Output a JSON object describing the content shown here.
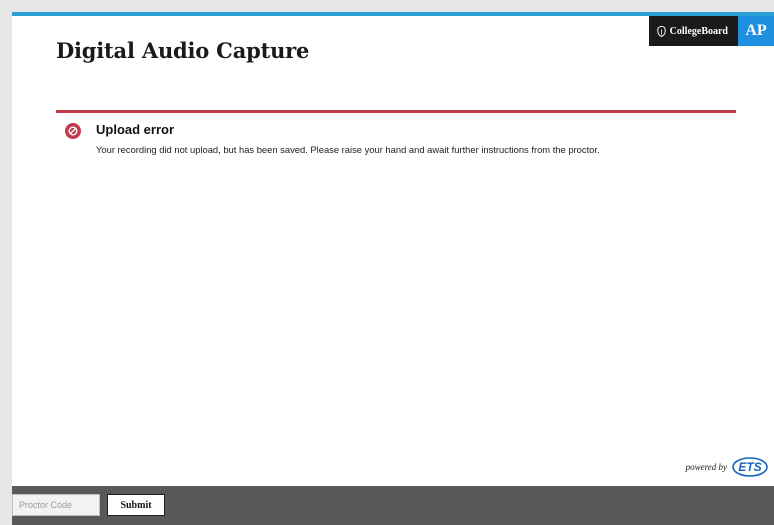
{
  "brand": {
    "collegeboard_label": "CollegeBoard",
    "ap_label": "AP"
  },
  "page": {
    "title": "Digital Audio Capture"
  },
  "alert": {
    "title": "Upload error",
    "message": "Your recording did not upload, but has been saved. Please raise your hand and await further instructions from the proctor.",
    "color": "#c23a4a",
    "icon": "no-entry-icon"
  },
  "powered_by": {
    "text": "powered by",
    "logo_text": "ETS"
  },
  "footer": {
    "proctor_code_placeholder": "Proctor Code",
    "submit_label": "Submit"
  },
  "colors": {
    "accent_bar": "#2f9fd8",
    "ap_blue": "#1f8fe0",
    "footer_bg": "#595959",
    "ets_blue": "#1565c0"
  }
}
